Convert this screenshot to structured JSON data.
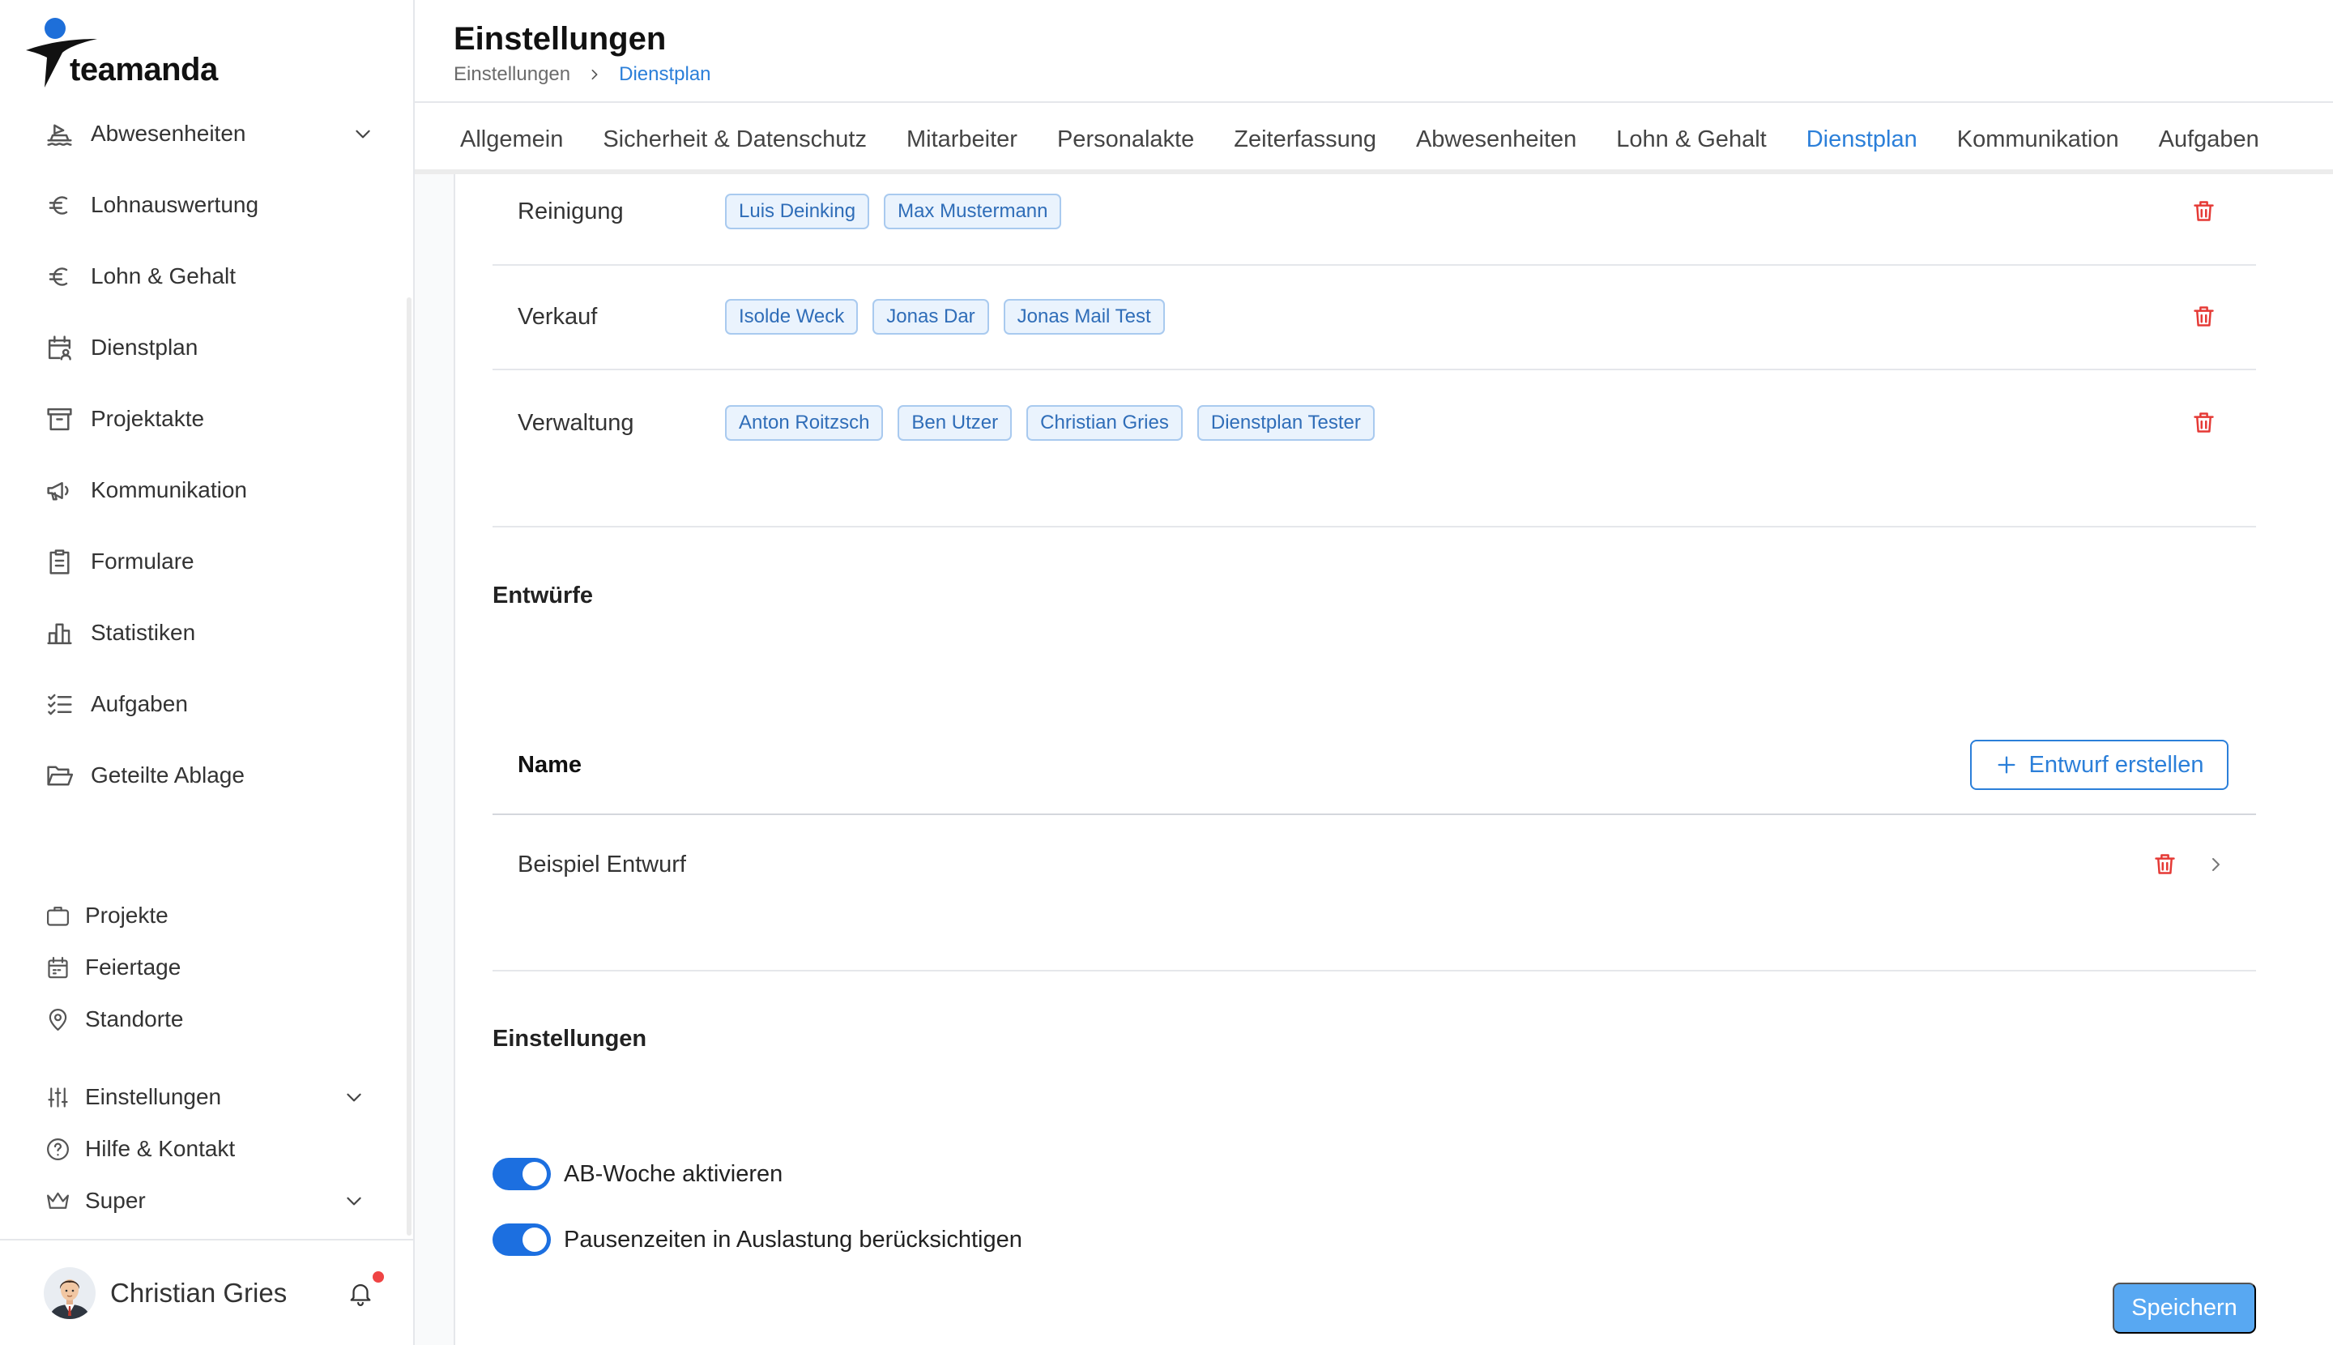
{
  "app": {
    "logo_text": "teamanda"
  },
  "sidebar": {
    "primary_items": [
      {
        "label": "Abwesenheiten",
        "icon": "beach-icon",
        "expandable": true
      },
      {
        "label": "Lohnauswertung",
        "icon": "euro-icon"
      },
      {
        "label": "Lohn & Gehalt",
        "icon": "euro-icon"
      },
      {
        "label": "Dienstplan",
        "icon": "calendar-user-icon"
      },
      {
        "label": "Projektakte",
        "icon": "archive-icon"
      },
      {
        "label": "Kommunikation",
        "icon": "megaphone-icon"
      },
      {
        "label": "Formulare",
        "icon": "clipboard-icon"
      },
      {
        "label": "Statistiken",
        "icon": "bar-chart-icon"
      },
      {
        "label": "Aufgaben",
        "icon": "checklist-icon"
      },
      {
        "label": "Geteilte Ablage",
        "icon": "folder-open-icon"
      }
    ],
    "secondary_items": [
      {
        "label": "Projekte",
        "icon": "briefcase-icon"
      },
      {
        "label": "Feiertage",
        "icon": "calendar-icon"
      },
      {
        "label": "Standorte",
        "icon": "map-pin-icon"
      }
    ],
    "footer_items": [
      {
        "label": "Einstellungen",
        "icon": "sliders-icon",
        "expandable": true
      },
      {
        "label": "Hilfe & Kontakt",
        "icon": "help-circle-icon"
      },
      {
        "label": "Super",
        "icon": "crown-icon",
        "expandable": true
      }
    ],
    "user": {
      "name": "Christian Gries",
      "has_notifications": true
    }
  },
  "header": {
    "title": "Einstellungen",
    "breadcrumb": [
      "Einstellungen",
      "Dienstplan"
    ]
  },
  "tabs": {
    "items": [
      {
        "label": "Allgemein",
        "active": false
      },
      {
        "label": "Sicherheit & Datenschutz",
        "active": false
      },
      {
        "label": "Mitarbeiter",
        "active": false
      },
      {
        "label": "Personalakte",
        "active": false
      },
      {
        "label": "Zeiterfassung",
        "active": false
      },
      {
        "label": "Abwesenheiten",
        "active": false
      },
      {
        "label": "Lohn & Gehalt",
        "active": false
      },
      {
        "label": "Dienstplan",
        "active": true
      },
      {
        "label": "Kommunikation",
        "active": false
      },
      {
        "label": "Aufgaben",
        "active": false
      }
    ]
  },
  "groups": [
    {
      "name": "Reinigung",
      "members": [
        "Luis Deinking",
        "Max Mustermann"
      ]
    },
    {
      "name": "Verkauf",
      "members": [
        "Isolde Weck",
        "Jonas Dar",
        "Jonas Mail Test"
      ]
    },
    {
      "name": "Verwaltung",
      "members": [
        "Anton Roitzsch",
        "Ben Utzer",
        "Christian Gries",
        "Dienstplan Tester"
      ]
    }
  ],
  "drafts": {
    "heading": "Entwürfe",
    "column_name": "Name",
    "create_label": "Entwurf erstellen",
    "rows": [
      {
        "name": "Beispiel Entwurf"
      }
    ]
  },
  "settings": {
    "heading": "Einstellungen",
    "toggles": [
      {
        "label": "AB-Woche aktivieren",
        "enabled": true
      },
      {
        "label": "Pausenzeiten in Auslastung berücksichtigen",
        "enabled": true
      }
    ],
    "save_label": "Speichern"
  },
  "colors": {
    "accent": "#2b7fd9",
    "danger": "#e53935",
    "tag_bg": "#eaf3fd",
    "tag_border": "#a9caef",
    "tag_text": "#2f6db8",
    "toggle_on": "#1c6fe0",
    "save_bg": "#58a8f2"
  }
}
